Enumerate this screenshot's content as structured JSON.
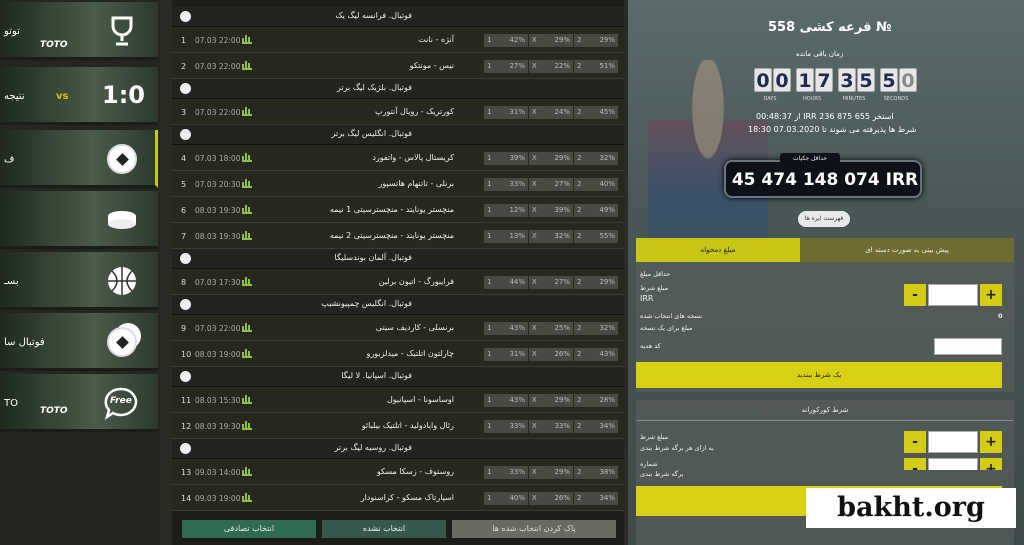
{
  "sidebar": {
    "tiles": [
      {
        "label": "توتو",
        "badge": "TOTO",
        "icon": "trophy-icon",
        "color": "#1f3a1e"
      },
      {
        "label": "نتیجه",
        "score": "1:0",
        "vs": "vs",
        "icon": "score-icon"
      },
      {
        "label": "ف",
        "icon": "soccer-ball-icon",
        "active": true
      },
      {
        "label": "",
        "icon": "hockey-puck-icon"
      },
      {
        "label": "بسـ",
        "icon": "basketball-icon"
      },
      {
        "label": "فوتبال سا",
        "icon": "flaming-ball-icon"
      },
      {
        "label": "TO",
        "badge": "TOTO",
        "icon": "free-toto-icon",
        "free": "Free"
      }
    ]
  },
  "matches": {
    "groups": [
      {
        "title": "فوتبال. فرانسه لیگ یک",
        "rows": [
          {
            "num": "1",
            "date": "07.03 22:00",
            "teams": "آنژه - نانت",
            "o1": "42%",
            "ox": "29%",
            "o2": "29%"
          },
          {
            "num": "2",
            "date": "07.03 22:00",
            "teams": "نیس - مونتکو",
            "o1": "27%",
            "ox": "22%",
            "o2": "51%"
          }
        ]
      },
      {
        "title": "فوتبال. بلژیک لیگ برتر",
        "rows": [
          {
            "num": "3",
            "date": "07.03 22:00",
            "teams": "کورتریک - رویال آنتورپ",
            "o1": "31%",
            "ox": "24%",
            "o2": "45%"
          }
        ]
      },
      {
        "title": "فوتبال. انگلیس لیگ برتر",
        "rows": [
          {
            "num": "4",
            "date": "07.03 18:00",
            "teams": "کریستال پالاس - واتفورد",
            "o1": "39%",
            "ox": "29%",
            "o2": "32%"
          },
          {
            "num": "5",
            "date": "07.03 20:30",
            "teams": "برنلی - تاتنهام هاتسپور",
            "o1": "33%",
            "ox": "27%",
            "o2": "40%"
          },
          {
            "num": "6",
            "date": "08.03 19:30",
            "teams": "منچستر یونایتد - منچسترسیتی 1 نیمه",
            "o1": "12%",
            "ox": "39%",
            "o2": "49%"
          },
          {
            "num": "7",
            "date": "08.03 19:30",
            "teams": "منچستر یونایتد - منچسترسیتی 2 نیمه",
            "o1": "13%",
            "ox": "32%",
            "o2": "55%"
          }
        ]
      },
      {
        "title": "فوتبال. آلمان بوندسلیگا",
        "rows": [
          {
            "num": "8",
            "date": "07.03 17:30",
            "teams": "فرایبورگ - اتیون برلین",
            "o1": "44%",
            "ox": "27%",
            "o2": "29%"
          }
        ]
      },
      {
        "title": "فوتبال. انگلیس چمپیونشیپ",
        "rows": [
          {
            "num": "9",
            "date": "07.03 22:00",
            "teams": "برنسلی - کاردیف سیتی",
            "o1": "43%",
            "ox": "25%",
            "o2": "32%"
          },
          {
            "num": "10",
            "date": "08.03 19:00",
            "teams": "چارلتون اتلتیک - میدلزبورو",
            "o1": "31%",
            "ox": "26%",
            "o2": "43%"
          }
        ]
      },
      {
        "title": "فوتبال. اسپانیا. لا لیگا",
        "rows": [
          {
            "num": "11",
            "date": "08.03 15:30",
            "teams": "اوساسونا - اسپانیول",
            "o1": "43%",
            "ox": "29%",
            "o2": "28%"
          },
          {
            "num": "12",
            "date": "08.03 19:30",
            "teams": "رئال وایادولید - اتلتیک بیلبائو",
            "o1": "33%",
            "ox": "33%",
            "o2": "34%"
          }
        ]
      },
      {
        "title": "فوتبال. روسیه لیگ برتر",
        "rows": [
          {
            "num": "13",
            "date": "09.03 14:00",
            "teams": "روستوف - زسکا مسکو",
            "o1": "33%",
            "ox": "29%",
            "o2": "38%"
          },
          {
            "num": "14",
            "date": "09.03 19:00",
            "teams": "اسپارتاک مسکو - کراسنودار",
            "o1": "40%",
            "ox": "26%",
            "o2": "34%"
          }
        ]
      }
    ],
    "odds_labels": {
      "home": "1",
      "draw": "X",
      "away": "2"
    }
  },
  "bottom_buttons": {
    "clear": "پاک کردن انتخاب شده ها",
    "none": "انتخاب نشده",
    "random": "انتخاب تصادفی"
  },
  "draw": {
    "title": "قرعه کشی 558 №",
    "remaining_label": "زمان باقی مانده",
    "countdown": {
      "d1": "0",
      "d2": "0",
      "h1": "1",
      "h2": "7",
      "m1": "3",
      "m2": "5",
      "s1": "5",
      "s2": "0"
    },
    "units": {
      "days": "DAYS",
      "hours": "HOURS",
      "minutes": "MINUTES",
      "seconds": "SECONDS"
    },
    "stats_line": "از 00:48:37 IRR استخر 655 875 236",
    "accept_line": "شرط ها پذیرفته می شوند تا 07.03.2020 18:30",
    "jackpot_label": "حداقل جکپات",
    "jackpot_value": "45 474 148 074 IRR",
    "history_button": "فهرست ایره ها"
  },
  "bet_tabs": {
    "tab_amount": "مبلغ دمخواه",
    "tab_system": "پیش بینی به صورت دسته ای"
  },
  "form1": {
    "min_label": "حداقل مبلغ",
    "amount_label": "مبلغ شرط",
    "currency": "IRR",
    "selected_label": "نسخه های انتخاب شده",
    "selected_value": "0",
    "per_label": "مبلغ برای یک نسخه",
    "promo_label": "کد هدیه",
    "submit": "یک شرط ببندید"
  },
  "form2": {
    "title": "شرط کورکورانه",
    "amount_label": "مبلغ شرط",
    "per_label": "به ازای هر برگه شرط بندی",
    "count_label": "شماره",
    "count_sub": "برگه شرط بندی"
  },
  "stepper": {
    "minus": "-",
    "plus": "+"
  },
  "watermark": "bakht.org",
  "colors": {
    "accent": "#d4cc14",
    "green_button": "#2e6b52"
  }
}
